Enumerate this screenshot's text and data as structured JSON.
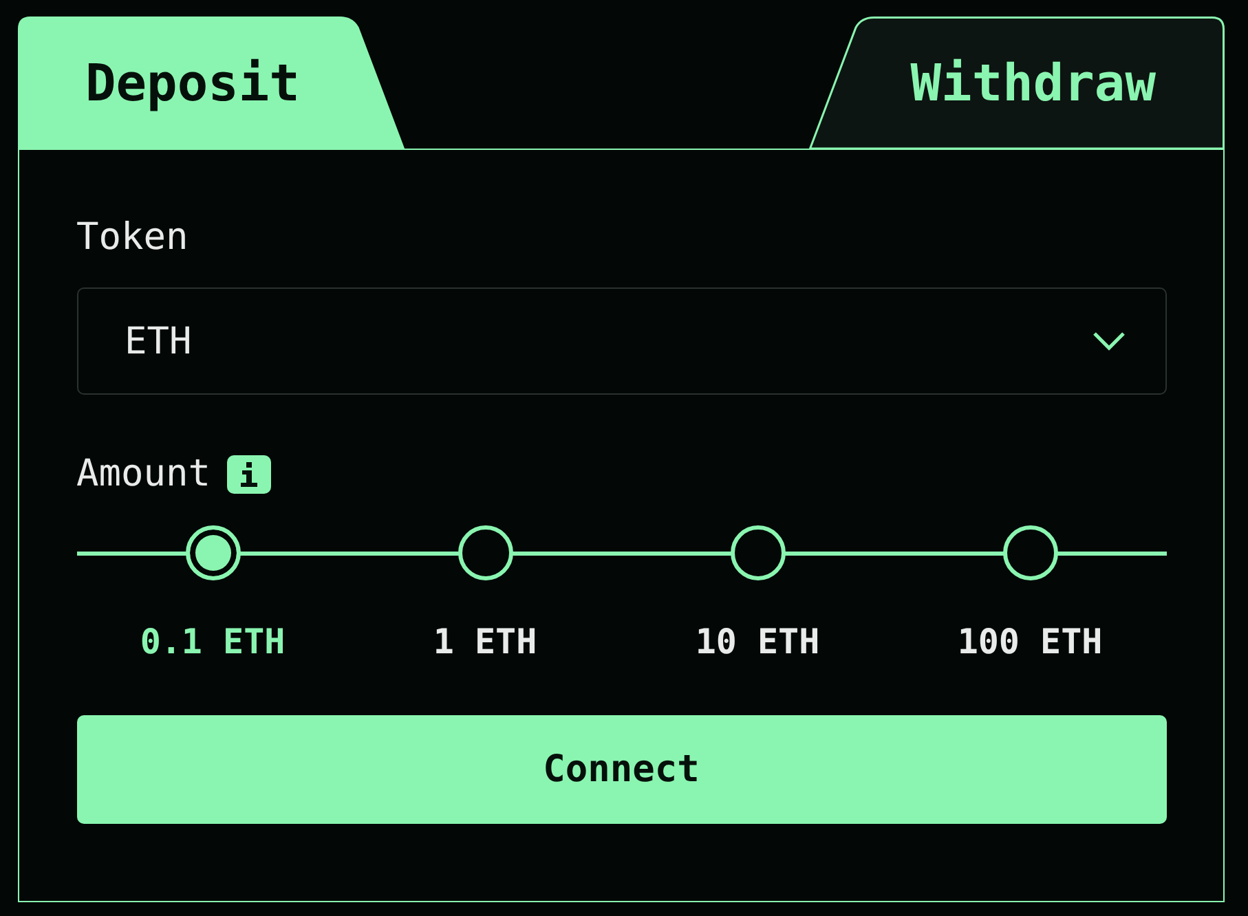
{
  "tabs": [
    {
      "label": "Deposit",
      "selected": true
    },
    {
      "label": "Withdraw",
      "selected": false
    }
  ],
  "token": {
    "label": "Token",
    "value": "ETH"
  },
  "amount": {
    "label": "Amount",
    "options": [
      {
        "label": "0.1 ETH",
        "selected": true
      },
      {
        "label": "1 ETH",
        "selected": false
      },
      {
        "label": "10 ETH",
        "selected": false
      },
      {
        "label": "100 ETH",
        "selected": false
      }
    ]
  },
  "connect_button": {
    "label": "Connect"
  }
}
